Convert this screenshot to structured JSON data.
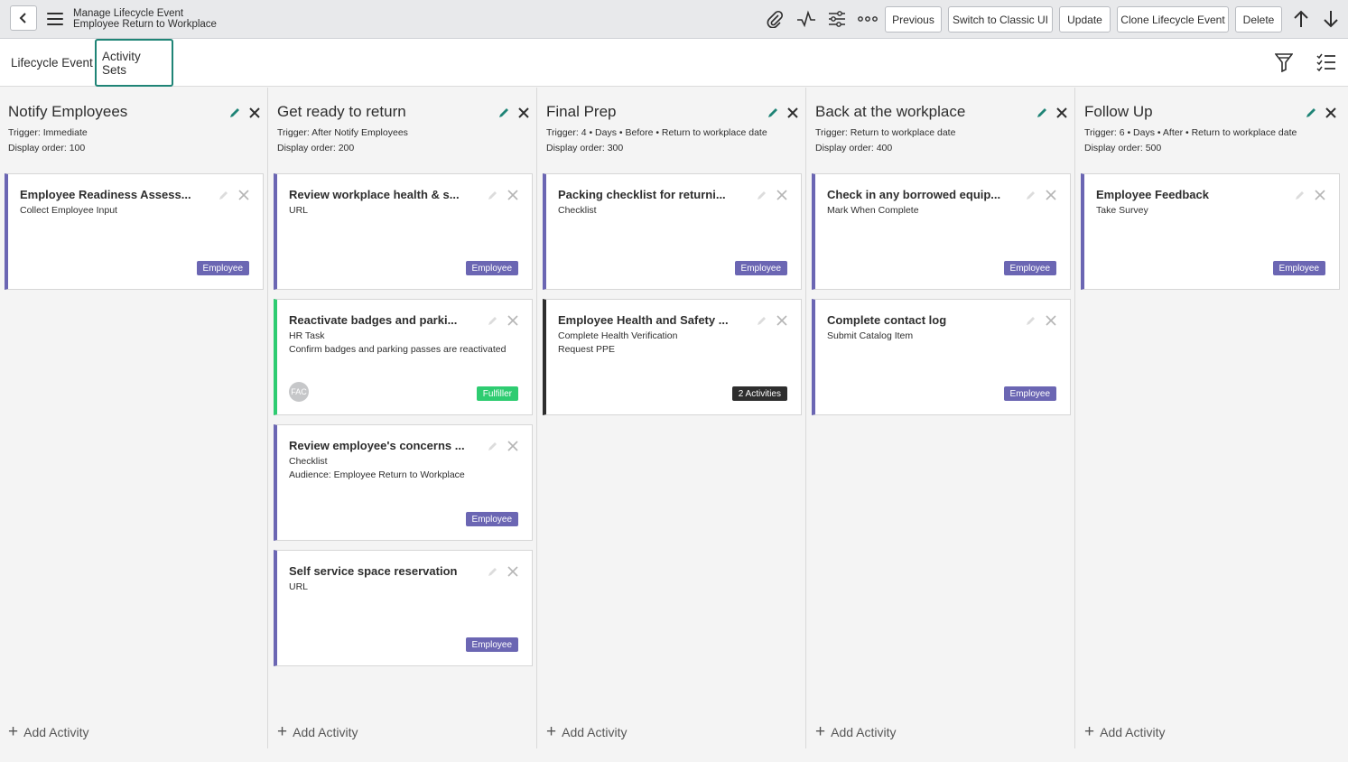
{
  "header": {
    "title_line1": "Manage Lifecycle Event",
    "title_line2": "Employee Return to Workplace",
    "buttons": {
      "previous": "Previous",
      "switch_classic": "Switch to Classic UI",
      "update": "Update",
      "clone": "Clone Lifecycle Event",
      "delete": "Delete"
    }
  },
  "tabs": {
    "lifecycle_event": "Lifecycle Event",
    "activity_sets": "Activity Sets"
  },
  "add_activity_label": "Add Activity",
  "columns": [
    {
      "title": "Notify Employees",
      "trigger": "Trigger: Immediate",
      "display_order": "Display order: 100",
      "cards": [
        {
          "title": "Employee Readiness Assess...",
          "lines": [
            "Collect Employee Input"
          ],
          "badge": "Employee"
        }
      ]
    },
    {
      "title": "Get ready to return",
      "trigger": "Trigger: After Notify Employees",
      "display_order": "Display order: 200",
      "cards": [
        {
          "title": "Review workplace health & s...",
          "lines": [
            "URL"
          ],
          "badge": "Employee"
        },
        {
          "title": "Reactivate badges and parki...",
          "lines": [
            "HR Task",
            "Confirm badges and parking passes are reactivated"
          ],
          "badge": "Fulfiller",
          "avatar": "FAC"
        },
        {
          "title": "Review employee's concerns ...",
          "lines": [
            "Checklist",
            "Audience: Employee Return to Workplace"
          ],
          "badge": "Employee"
        },
        {
          "title": "Self service space reservation",
          "lines": [
            "URL"
          ],
          "badge": "Employee"
        }
      ]
    },
    {
      "title": "Final Prep",
      "trigger": "Trigger: 4 • Days • Before • Return to workplace date",
      "display_order": "Display order: 300",
      "cards": [
        {
          "title": "Packing checklist for returni...",
          "lines": [
            "Checklist"
          ],
          "badge": "Employee"
        },
        {
          "title": "Employee Health and Safety ...",
          "lines": [
            "Complete Health Verification",
            "Request PPE"
          ],
          "badge": "2 Activities"
        }
      ]
    },
    {
      "title": "Back at the workplace",
      "trigger": "Trigger: Return to workplace date",
      "display_order": "Display order: 400",
      "cards": [
        {
          "title": "Check in any borrowed equip...",
          "lines": [
            "Mark When Complete"
          ],
          "badge": "Employee"
        },
        {
          "title": "Complete contact log",
          "lines": [
            "Submit Catalog Item"
          ],
          "badge": "Employee"
        }
      ]
    },
    {
      "title": "Follow Up",
      "trigger": "Trigger: 6 • Days • After • Return to workplace date",
      "display_order": "Display order: 500",
      "cards": [
        {
          "title": "Employee Feedback",
          "lines": [
            "Take Survey"
          ],
          "badge": "Employee"
        }
      ]
    }
  ],
  "colors": {
    "accent_teal": "#1f8476",
    "employee_badge": "#6b66b3",
    "fulfiller_badge": "#2ecc71",
    "activities_badge": "#2e2e2e"
  },
  "icons": [
    "back-icon",
    "menu-icon",
    "attachment-icon",
    "activity-icon",
    "settings-sliders-icon",
    "more-icon",
    "arrow-up-icon",
    "arrow-down-icon",
    "filter-icon",
    "checklist-icon",
    "edit-icon",
    "close-icon",
    "plus-icon"
  ]
}
